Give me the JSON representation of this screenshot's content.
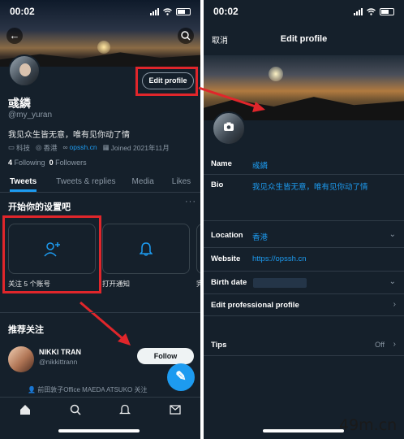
{
  "left": {
    "status": {
      "time": "00:02"
    },
    "profile": {
      "name": "彧繗",
      "handle": "@my_yuran",
      "bio": "我见众生皆无意，唯有见你动了情",
      "edit_button": "Edit profile",
      "meta": {
        "category": "科技",
        "location": "香港",
        "link": "opssh.cn",
        "joined": "Joined 2021年11月"
      },
      "following_count": "4",
      "following_label": "Following",
      "followers_count": "0",
      "followers_label": "Followers"
    },
    "tabs": [
      {
        "label": "Tweets"
      },
      {
        "label": "Tweets & replies"
      },
      {
        "label": "Media"
      },
      {
        "label": "Likes"
      }
    ],
    "setup": {
      "title": "开始你的设置吧",
      "cards": [
        {
          "label": "关注 5 个账号",
          "icon": "add-user-icon"
        },
        {
          "label": "打开通知",
          "icon": "bell-icon"
        },
        {
          "label": "完"
        }
      ]
    },
    "recommend": {
      "title": "推荐关注",
      "user_name": "NIKKI TRAN",
      "user_handle": "@nikkittrann",
      "follow_label": "Follow",
      "followed_by": "前田敦子Office MAEDA ATSUKO 关注"
    },
    "nav": [
      "home-icon",
      "search-icon",
      "bell-icon",
      "mail-icon"
    ]
  },
  "right": {
    "status": {
      "time": "00:02"
    },
    "header": {
      "cancel": "取消",
      "title": "Edit profile"
    },
    "fields": {
      "name_label": "Name",
      "name_value": "彧繗",
      "bio_label": "Bio",
      "bio_value": "我见众生皆无意，唯有见你动了情",
      "location_label": "Location",
      "location_value": "香港",
      "website_label": "Website",
      "website_value": "https://opssh.cn",
      "birth_label": "Birth date",
      "pro_label": "Edit professional profile",
      "tips_label": "Tips",
      "tips_value": "Off"
    }
  },
  "watermark": "49m.cn",
  "colors": {
    "background": "#15202b",
    "accent": "#1d9bf0",
    "highlight": "#e0262b"
  }
}
